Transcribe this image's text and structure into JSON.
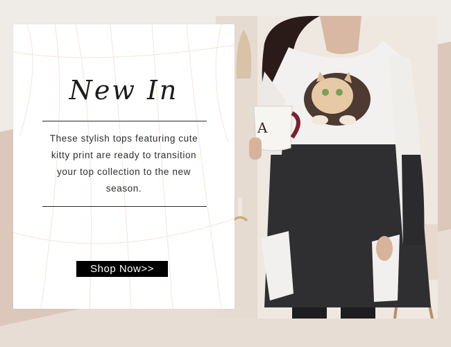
{
  "banner": {
    "title": "New In",
    "description": "These stylish tops featuring cute kitty print are ready to transition your top collection to the new season.",
    "cta_label": "Shop Now>>"
  },
  "colors": {
    "background": "#efece7",
    "accent_stripe": "#d9c3b7",
    "card": "#ffffff",
    "button": "#000000",
    "button_text": "#ffffff",
    "garment_top": "#f2f0ee",
    "garment_bottom": "#2f2f31"
  },
  "photo": {
    "subject": "model wearing colour-block long top with cat print holding a mug"
  }
}
